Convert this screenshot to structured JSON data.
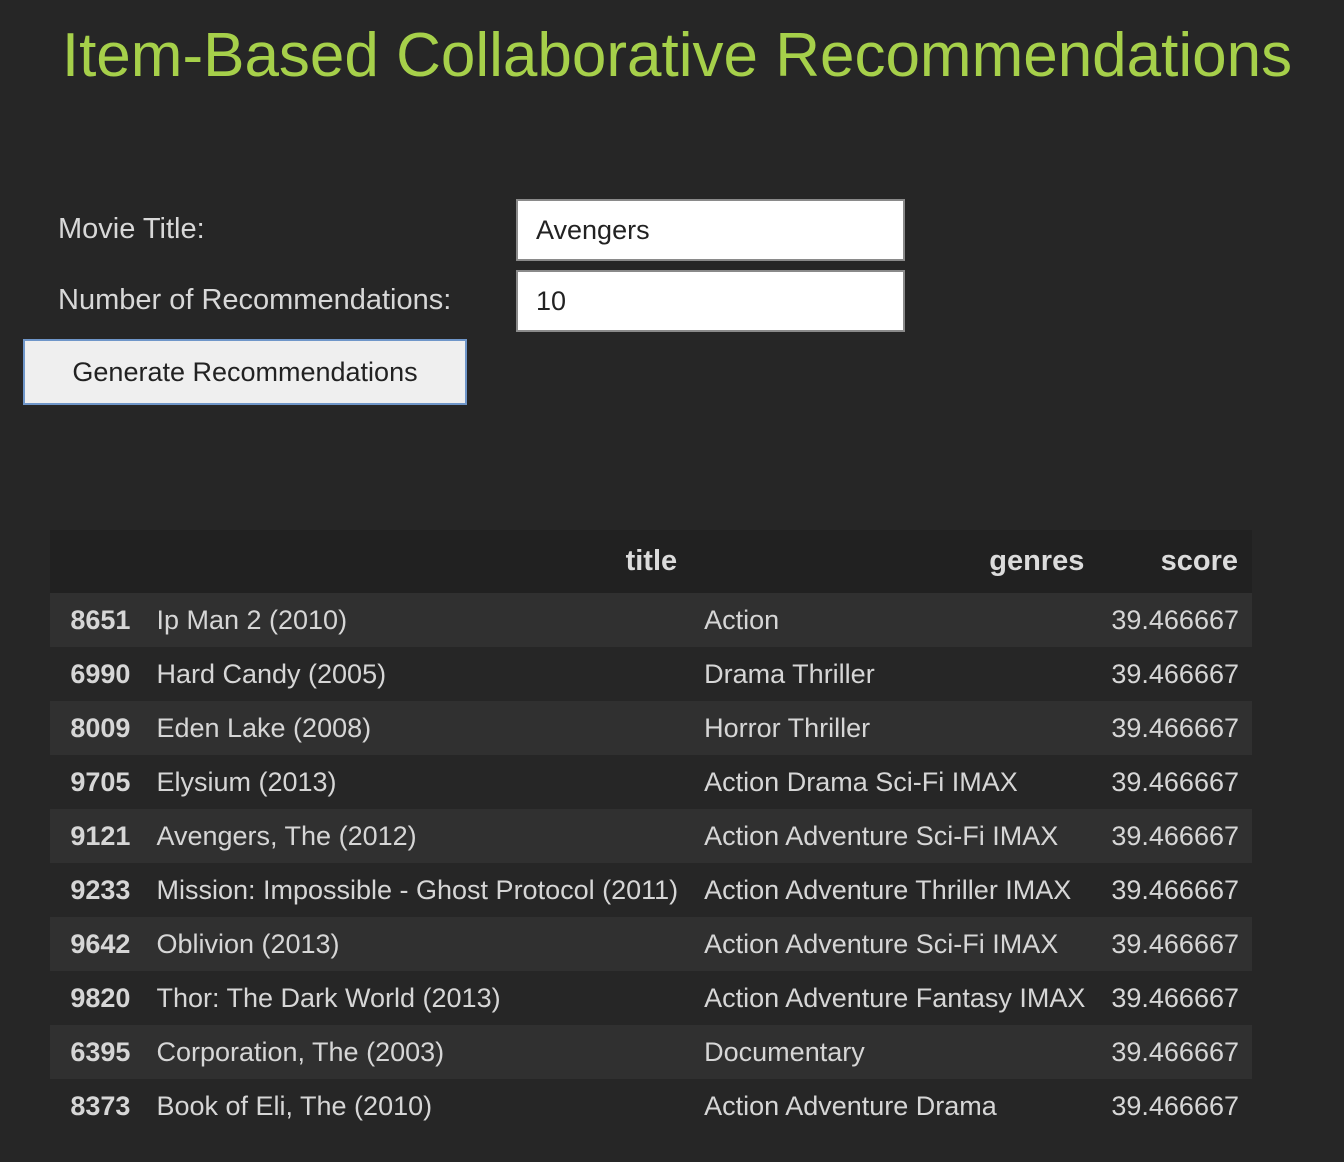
{
  "page": {
    "heading": "Item-Based Collaborative Recommendations"
  },
  "form": {
    "movie_title_label": "Movie Title:",
    "movie_title_value": "Avengers",
    "num_recs_label": "Number of Recommendations:",
    "num_recs_value": "10",
    "generate_label": "Generate Recommendations"
  },
  "results": {
    "columns": [
      "",
      "title",
      "genres",
      "score"
    ],
    "rows": [
      {
        "index": "8651",
        "title": "Ip Man 2 (2010)",
        "genres": "Action",
        "score": "39.466667"
      },
      {
        "index": "6990",
        "title": "Hard Candy (2005)",
        "genres": "Drama Thriller",
        "score": "39.466667"
      },
      {
        "index": "8009",
        "title": "Eden Lake (2008)",
        "genres": "Horror Thriller",
        "score": "39.466667"
      },
      {
        "index": "9705",
        "title": "Elysium (2013)",
        "genres": "Action Drama Sci-Fi IMAX",
        "score": "39.466667"
      },
      {
        "index": "9121",
        "title": "Avengers, The (2012)",
        "genres": "Action Adventure Sci-Fi IMAX",
        "score": "39.466667"
      },
      {
        "index": "9233",
        "title": "Mission: Impossible - Ghost Protocol (2011)",
        "genres": "Action Adventure Thriller IMAX",
        "score": "39.466667"
      },
      {
        "index": "9642",
        "title": "Oblivion (2013)",
        "genres": "Action Adventure Sci-Fi IMAX",
        "score": "39.466667"
      },
      {
        "index": "9820",
        "title": "Thor: The Dark World (2013)",
        "genres": "Action Adventure Fantasy IMAX",
        "score": "39.466667"
      },
      {
        "index": "6395",
        "title": "Corporation, The (2003)",
        "genres": "Documentary",
        "score": "39.466667"
      },
      {
        "index": "8373",
        "title": "Book of Eli, The (2010)",
        "genres": "Action Adventure Drama",
        "score": "39.466667"
      }
    ]
  },
  "colors": {
    "background": "#262626",
    "heading": "#a6d04a",
    "button_border": "#6f96c9"
  }
}
